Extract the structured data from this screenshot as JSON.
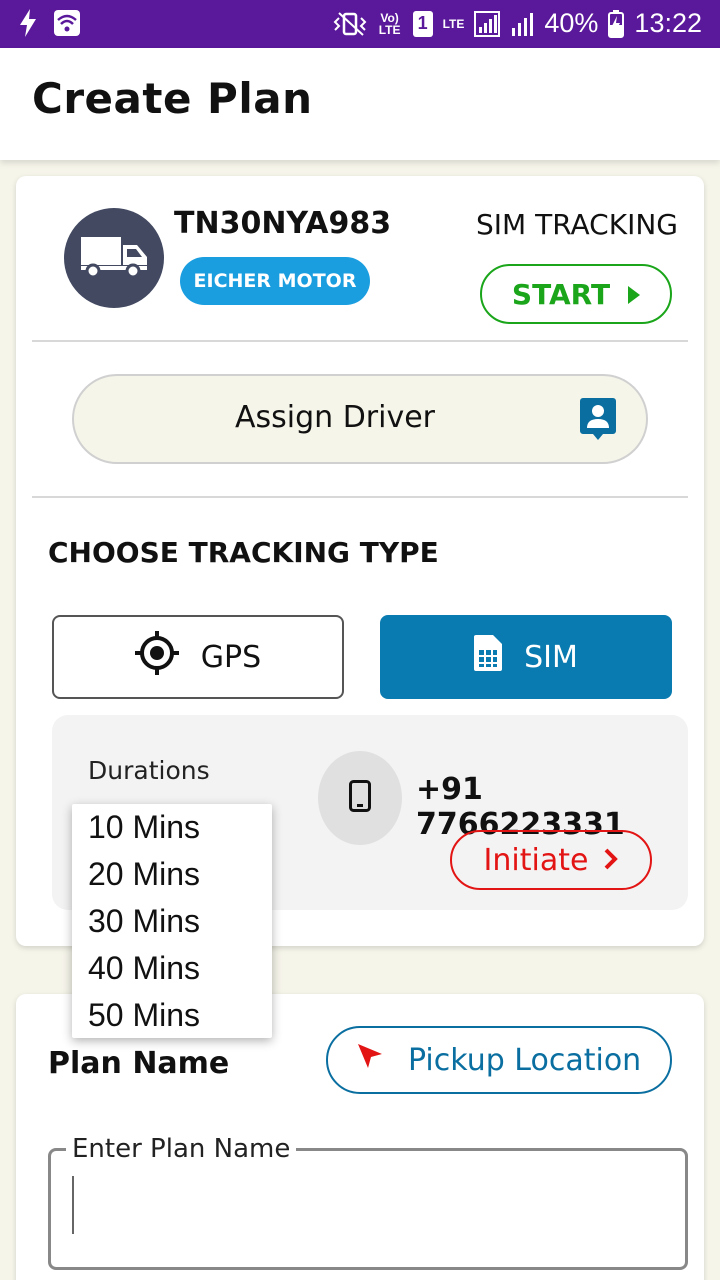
{
  "status_bar": {
    "battery": "40%",
    "time": "13:22",
    "volte": "Vo) LTE",
    "sim_slot": "1",
    "lte": "LTE"
  },
  "header": {
    "title": "Create Plan"
  },
  "vehicle": {
    "registration": "TN30NYA983",
    "brand": "EICHER MOTOR",
    "tracking_label": "SIM TRACKING",
    "start_label": "START"
  },
  "assign_driver": {
    "label": "Assign Driver"
  },
  "tracking": {
    "title": "CHOOSE TRACKING TYPE",
    "options": [
      {
        "label": "GPS",
        "selected": false
      },
      {
        "label": "SIM",
        "selected": true
      }
    ],
    "durations_label": "Durations",
    "phone_number": "+91 7766223331",
    "initiate_label": "Initiate"
  },
  "durations_menu": {
    "options": [
      "10 Mins",
      "20 Mins",
      "30 Mins",
      "40 Mins",
      "50 Mins"
    ]
  },
  "plan": {
    "name_label": "Plan Name",
    "pickup_label": "Pickup Location",
    "input_label": "Enter Plan Name",
    "input_value": ""
  },
  "colors": {
    "status_bar": "#5a189a",
    "brand_badge": "#1b9ee0",
    "start_green": "#1aa51a",
    "sim_selected": "#0a7bb0",
    "initiate_red": "#e31414",
    "pickup_blue": "#0a6fa0"
  }
}
